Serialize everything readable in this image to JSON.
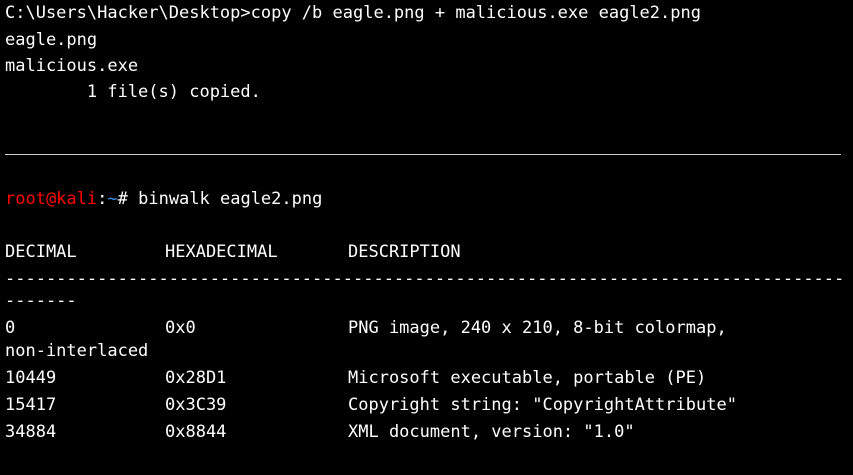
{
  "cmd_section": {
    "command_line": "C:\\Users\\Hacker\\Desktop>copy /b eagle.png + malicious.exe eagle2.png",
    "output_1": "eagle.png",
    "output_2": "malicious.exe",
    "output_3": "        1 file(s) copied."
  },
  "kali_section": {
    "prompt_user": "root@kali",
    "prompt_colon": ":",
    "prompt_path": "~",
    "prompt_hash": "# ",
    "command": "binwalk eagle2.png"
  },
  "binwalk": {
    "headers": [
      "DECIMAL",
      "HEXADECIMAL",
      "DESCRIPTION"
    ],
    "separator_1": "--------------------------------------------------------------------------------------------",
    "separator_2": "-------",
    "rows": [
      {
        "decimal": "0",
        "hex": "0x0",
        "description": "PNG image, 240 x 210, 8-bit colormap,",
        "wrap": "non-interlaced"
      },
      {
        "decimal": "10449",
        "hex": "0x28D1",
        "description": "Microsoft executable, portable (PE)"
      },
      {
        "decimal": "15417",
        "hex": "0x3C39",
        "description": "Copyright string: \"CopyrightAttribute\""
      },
      {
        "decimal": "34884",
        "hex": "0x8844",
        "description": "XML document, version: \"1.0\""
      }
    ]
  },
  "colors": {
    "background": "#000000",
    "text": "#ffffff",
    "prompt_user": "#ff0000",
    "prompt_path": "#3b8eea"
  }
}
